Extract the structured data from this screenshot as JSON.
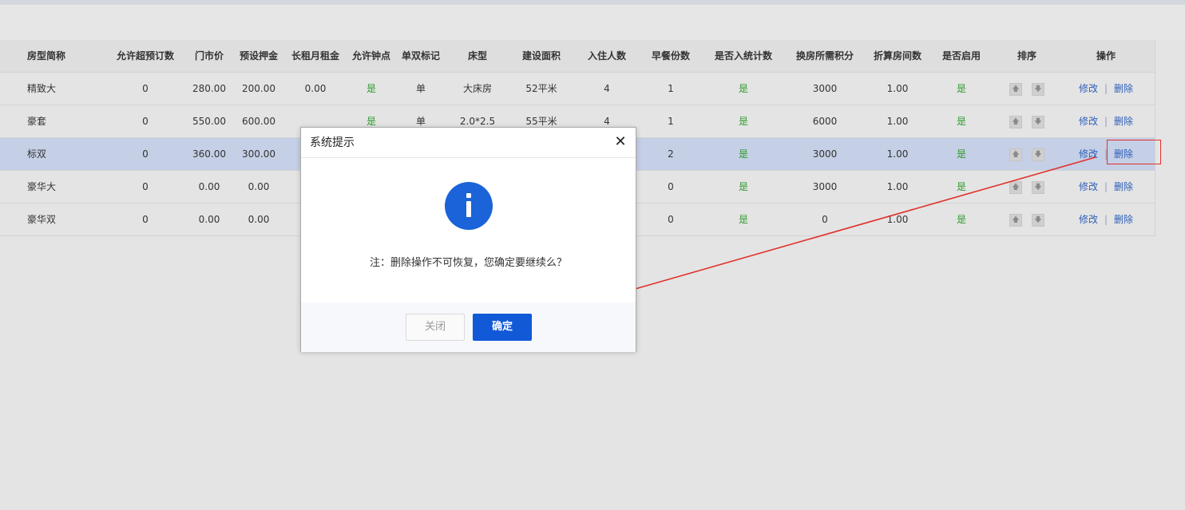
{
  "table": {
    "headers": [
      "房型简称",
      "允许超预订数",
      "门市价",
      "预设押金",
      "长租月租金",
      "允许钟点",
      "单双标记",
      "床型",
      "建设面积",
      "入住人数",
      "早餐份数",
      "是否入统计数",
      "换房所需积分",
      "折算房间数",
      "是否启用",
      "排序",
      "操作"
    ],
    "rows": [
      {
        "name": "精致大",
        "overbook": "0",
        "price": "280.00",
        "deposit": "200.00",
        "rent": "0.00",
        "hourly": "是",
        "single_double": "单",
        "bed": "大床房",
        "area": "52平米",
        "guests": "4",
        "breakfast": "1",
        "counted": "是",
        "points": "3000",
        "room_count": "1.00",
        "enabled": "是",
        "edit": "修改",
        "delete": "删除"
      },
      {
        "name": "豪套",
        "overbook": "0",
        "price": "550.00",
        "deposit": "600.00",
        "rent": "",
        "hourly": "是",
        "single_double": "单",
        "bed": "2.0*2.5",
        "area": "55平米",
        "guests": "4",
        "breakfast": "1",
        "counted": "是",
        "points": "6000",
        "room_count": "1.00",
        "enabled": "是",
        "edit": "修改",
        "delete": "删除"
      },
      {
        "name": "标双",
        "overbook": "0",
        "price": "360.00",
        "deposit": "300.00",
        "rent": "",
        "hourly": "",
        "single_double": "",
        "bed": "",
        "area": "",
        "guests": "",
        "breakfast": "2",
        "counted": "是",
        "points": "3000",
        "room_count": "1.00",
        "enabled": "是",
        "edit": "修改",
        "delete": "删除"
      },
      {
        "name": "豪华大",
        "overbook": "0",
        "price": "0.00",
        "deposit": "0.00",
        "rent": "",
        "hourly": "",
        "single_double": "",
        "bed": "",
        "area": "",
        "guests": "",
        "breakfast": "0",
        "counted": "是",
        "points": "3000",
        "room_count": "1.00",
        "enabled": "是",
        "edit": "修改",
        "delete": "删除"
      },
      {
        "name": "豪华双",
        "overbook": "0",
        "price": "0.00",
        "deposit": "0.00",
        "rent": "",
        "hourly": "",
        "single_double": "",
        "bed": "",
        "area": "",
        "guests": "",
        "breakfast": "0",
        "counted": "是",
        "points": "0",
        "room_count": "1.00",
        "enabled": "是",
        "edit": "修改",
        "delete": "删除"
      }
    ],
    "selected_row": 2
  },
  "dialog": {
    "title": "系统提示",
    "close_glyph": "✕",
    "icon": "info-icon",
    "message": "注：删除操作不可恢复，您确定要继续么？",
    "close_button": "关闭",
    "confirm_button": "确定"
  },
  "icons": {
    "sort_up": "🡅",
    "sort_down": "🡇"
  },
  "colors": {
    "accent": "#1259d8",
    "yes_green": "#2f9a2f",
    "link": "#2f5fb8",
    "highlight": "#e0312c",
    "selected_row": "#c5cfe5"
  }
}
